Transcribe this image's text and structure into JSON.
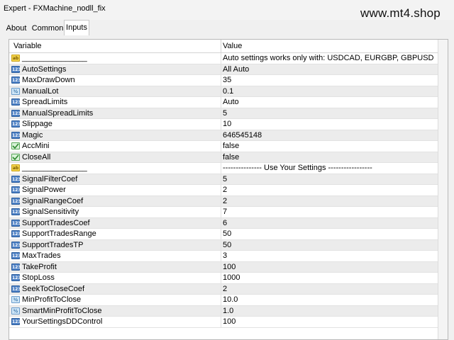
{
  "window": {
    "title": "Expert - FXMachine_nodll_fix",
    "watermark": "www.mt4.shop"
  },
  "tabs": [
    {
      "label": "About"
    },
    {
      "label": "Common"
    },
    {
      "label": "Inputs"
    }
  ],
  "table": {
    "columns": {
      "variable": "Variable",
      "value": "Value"
    },
    "rows": [
      {
        "icon": "str",
        "variable": "_______________",
        "value": "Auto settings works only with: USDCAD, EURGBP, GBPUSD, EURU..."
      },
      {
        "icon": "num",
        "variable": "AutoSettings",
        "value": "All Auto"
      },
      {
        "icon": "num",
        "variable": "MaxDrawDown",
        "value": "35"
      },
      {
        "icon": "dbl",
        "variable": "ManualLot",
        "value": "0.1"
      },
      {
        "icon": "num",
        "variable": "SpreadLimits",
        "value": "Auto"
      },
      {
        "icon": "num",
        "variable": "ManualSpreadLimits",
        "value": "5"
      },
      {
        "icon": "num",
        "variable": "Slippage",
        "value": "10"
      },
      {
        "icon": "num",
        "variable": "Magic",
        "value": "646545148"
      },
      {
        "icon": "bool",
        "variable": "AccMini",
        "value": "false"
      },
      {
        "icon": "bool",
        "variable": "CloseAll",
        "value": "false"
      },
      {
        "icon": "str",
        "variable": "_______________",
        "value": "---------------  Use Your Settings -----------------"
      },
      {
        "icon": "num",
        "variable": "SignalFilterCoef",
        "value": "5"
      },
      {
        "icon": "num",
        "variable": "SignalPower",
        "value": "2"
      },
      {
        "icon": "num",
        "variable": "SignalRangeCoef",
        "value": "2"
      },
      {
        "icon": "num",
        "variable": "SignalSensitivity",
        "value": "7"
      },
      {
        "icon": "num",
        "variable": "SupportTradesCoef",
        "value": "6"
      },
      {
        "icon": "num",
        "variable": "SupportTradesRange",
        "value": "50"
      },
      {
        "icon": "num",
        "variable": "SupportTradesTP",
        "value": "50"
      },
      {
        "icon": "num",
        "variable": "MaxTrades",
        "value": "3"
      },
      {
        "icon": "num",
        "variable": "TakeProfit",
        "value": "100"
      },
      {
        "icon": "num",
        "variable": "StopLoss",
        "value": "1000"
      },
      {
        "icon": "num",
        "variable": "SeekToCloseCoef",
        "value": "2"
      },
      {
        "icon": "dbl",
        "variable": "MinProfitToClose",
        "value": "10.0"
      },
      {
        "icon": "dbl",
        "variable": "SmartMinProfitToClose",
        "value": "1.0"
      },
      {
        "icon": "num",
        "variable": "YourSettingsDDControl",
        "value": "100"
      }
    ]
  }
}
